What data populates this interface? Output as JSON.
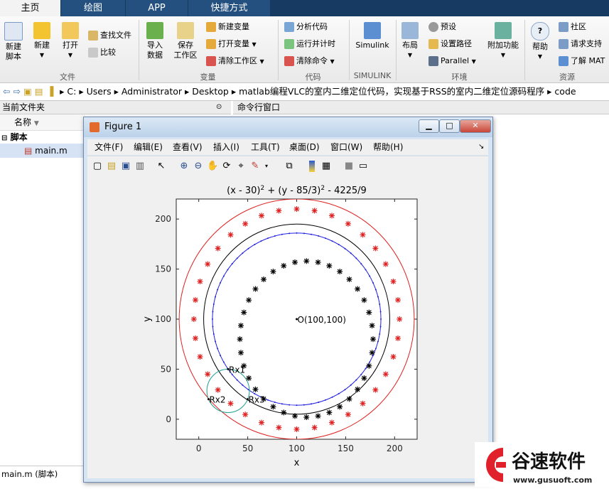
{
  "ribbon": {
    "tabs": [
      "主页",
      "绘图",
      "APP",
      "快捷方式"
    ],
    "file_group": {
      "new_script": "新建\n脚本",
      "new": "新建",
      "open": "打开",
      "find_files": "查找文件",
      "compare": "比较",
      "label": "文件"
    },
    "var_group": {
      "import": "导入\n数据",
      "save_ws": "保存\n工作区",
      "new_var": "新建变量",
      "open_var": "打开变量",
      "clear_ws": "清除工作区",
      "label": "变量"
    },
    "code_group": {
      "analyze": "分析代码",
      "run_time": "运行并计时",
      "clear_cmd": "清除命令",
      "label": "代码"
    },
    "simulink_group": {
      "simulink": "Simulink",
      "label": "SIMULINK"
    },
    "env_group": {
      "layout": "布局",
      "prefs": "预设",
      "set_path": "设置路径",
      "parallel": "Parallel",
      "addons": "附加功能",
      "label": "环境"
    },
    "res_group": {
      "help": "帮助",
      "community": "社区",
      "support": "请求支持",
      "learn": "了解 MAT",
      "label": "资源"
    }
  },
  "address": {
    "crumbs": [
      "C:",
      "Users",
      "Administrator",
      "Desktop",
      "matlab编程VLC的室内二维定位代码，实现基于RSS的室内二维定位源码程序",
      "code"
    ]
  },
  "panes": {
    "current_folder": "当前文件夹",
    "command_window": "命令行窗口",
    "column_name": "名称",
    "tree_group": "脚本",
    "file": "main.m",
    "status": "main.m  (脚本)"
  },
  "figure": {
    "title": "Figure 1",
    "menu": [
      "文件(F)",
      "编辑(E)",
      "查看(V)",
      "插入(I)",
      "工具(T)",
      "桌面(D)",
      "窗口(W)",
      "帮助(H)"
    ],
    "toolbar_icons": [
      "new-figure-icon",
      "open-icon",
      "save-icon",
      "print-icon",
      "pointer-icon",
      "zoom-in-icon",
      "zoom-out-icon",
      "pan-icon",
      "rotate-icon",
      "data-cursor-icon",
      "brush-icon",
      "link-icon",
      "colorbar-icon",
      "legend-icon",
      "hide-tools-icon",
      "dock-icon"
    ]
  },
  "chart_data": {
    "type": "scatter",
    "title": "(x - 30)^2 + (y - 85/3)^2 - 4225/9",
    "xlabel": "x",
    "ylabel": "y",
    "xlim": [
      -23,
      223
    ],
    "ylim": [
      -20,
      220
    ],
    "xticks": [
      0,
      50,
      100,
      150,
      200
    ],
    "yticks": [
      0,
      50,
      100,
      150,
      200
    ],
    "circles": [
      {
        "name": "red",
        "cx": 100,
        "cy": 100,
        "r": 120,
        "color": "#e02020"
      },
      {
        "name": "black",
        "cx": 100,
        "cy": 100,
        "r": 95,
        "color": "#000000"
      },
      {
        "name": "blue",
        "cx": 100,
        "cy": 100,
        "r": 86,
        "color": "#2020e0"
      },
      {
        "name": "teal",
        "cx": 30,
        "cy": 28.33,
        "r": 21.67,
        "color": "#20a090"
      }
    ],
    "marker_rings": [
      {
        "color": "#e02020",
        "cx": 100,
        "cy": 100,
        "rx": 105,
        "ry": 110,
        "count": 36
      },
      {
        "color": "#000000",
        "cx": 110,
        "cy": 80,
        "rx": 68,
        "ry": 78,
        "count": 36
      }
    ],
    "annotations": [
      {
        "text": "O(100,100)",
        "x": 100,
        "y": 100
      },
      {
        "text": "Rx1",
        "x": 30,
        "y": 50
      },
      {
        "text": "Rx2",
        "x": 10,
        "y": 20
      },
      {
        "text": "Rx3",
        "x": 50,
        "y": 20
      }
    ]
  },
  "watermark": {
    "brand": "谷速软件",
    "url": "www.gusuoft.com"
  }
}
